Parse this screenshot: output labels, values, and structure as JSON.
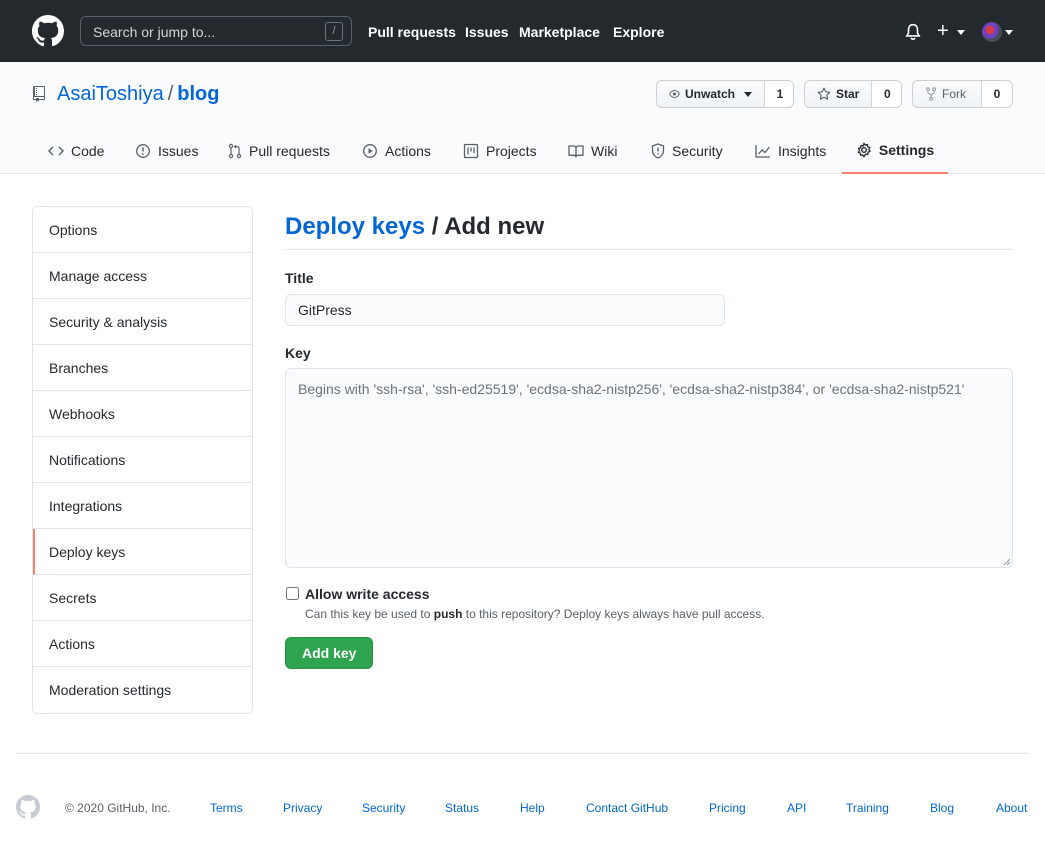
{
  "header": {
    "search_placeholder": "Search or jump to...",
    "search_shortcut": "/",
    "nav": [
      "Pull requests",
      "Issues",
      "Marketplace",
      "Explore"
    ],
    "plus": "+"
  },
  "repo": {
    "owner": "AsaiToshiya",
    "separator": "/",
    "name": "blog",
    "watch": {
      "label": "Unwatch",
      "count": "1"
    },
    "star": {
      "label": "Star",
      "count": "0"
    },
    "fork": {
      "label": "Fork",
      "count": "0"
    }
  },
  "tabs": [
    {
      "label": "Code",
      "icon": "code-icon"
    },
    {
      "label": "Issues",
      "icon": "issue-icon"
    },
    {
      "label": "Pull requests",
      "icon": "pull-request-icon"
    },
    {
      "label": "Actions",
      "icon": "play-icon"
    },
    {
      "label": "Projects",
      "icon": "project-icon"
    },
    {
      "label": "Wiki",
      "icon": "book-icon"
    },
    {
      "label": "Security",
      "icon": "shield-icon"
    },
    {
      "label": "Insights",
      "icon": "graph-icon"
    },
    {
      "label": "Settings",
      "icon": "gear-icon",
      "selected": true
    }
  ],
  "sidebar": {
    "items": [
      {
        "label": "Options"
      },
      {
        "label": "Manage access"
      },
      {
        "label": "Security & analysis"
      },
      {
        "label": "Branches"
      },
      {
        "label": "Webhooks"
      },
      {
        "label": "Notifications"
      },
      {
        "label": "Integrations"
      },
      {
        "label": "Deploy keys",
        "active": true
      },
      {
        "label": "Secrets"
      },
      {
        "label": "Actions"
      },
      {
        "label": "Moderation settings"
      }
    ]
  },
  "main": {
    "breadcrumb_link": "Deploy keys",
    "breadcrumb_rest": " / Add new",
    "title_label": "Title",
    "title_value": "GitPress",
    "key_label": "Key",
    "key_placeholder": "Begins with 'ssh-rsa', 'ssh-ed25519', 'ecdsa-sha2-nistp256', 'ecdsa-sha2-nistp384', or 'ecdsa-sha2-nistp521'",
    "allow_write_label": "Allow write access",
    "allow_write_checked": false,
    "note_before": "Can this key be used to ",
    "note_bold": "push",
    "note_after": " to this repository? Deploy keys always have pull access.",
    "submit_label": "Add key"
  },
  "footer": {
    "copyright": "© 2020 GitHub, Inc.",
    "links": [
      "Terms",
      "Privacy",
      "Security",
      "Status",
      "Help",
      "Contact GitHub",
      "Pricing",
      "API",
      "Training",
      "Blog",
      "About"
    ]
  },
  "colors": {
    "header_bg": "#24292e",
    "link": "#0366d6",
    "accent_underline": "#f9826c",
    "primary_button": "#2ea44f"
  }
}
